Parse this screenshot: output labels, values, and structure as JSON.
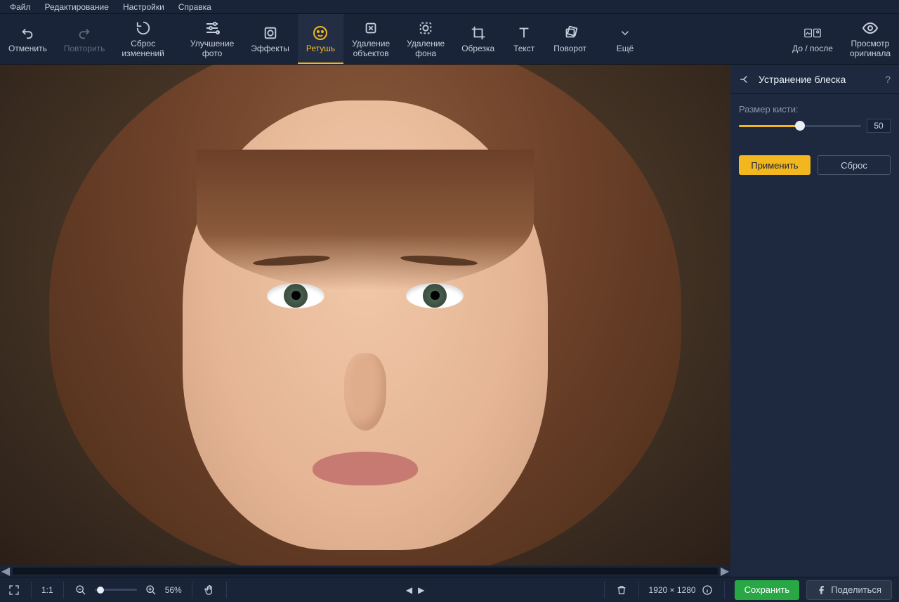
{
  "menubar": [
    "Файл",
    "Редактирование",
    "Настройки",
    "Справка"
  ],
  "toolbar": {
    "undo": "Отменить",
    "redo": "Повторить",
    "reset": "Сброс\nизменений",
    "enhance": "Улучшение\nфото",
    "effects": "Эффекты",
    "retouch": "Ретушь",
    "obj_remove": "Удаление\nобъектов",
    "bg_remove": "Удаление\nфона",
    "crop": "Обрезка",
    "text": "Текст",
    "rotate": "Поворот",
    "more": "Ещё",
    "before_after": "До / после",
    "view_original": "Просмотр\nоригинала"
  },
  "sidepanel": {
    "title": "Устранение блеска",
    "help": "?",
    "brush_label": "Размер кисти:",
    "brush_value": "50",
    "apply": "Применить",
    "reset": "Сброс"
  },
  "bottombar": {
    "one_to_one": "1:1",
    "zoom_pct": "56%",
    "dimensions": "1920 × 1280",
    "save": "Сохранить",
    "share": "Поделиться"
  },
  "colors": {
    "accent": "#f2b61e",
    "bg": "#1a2438",
    "panel": "#1e2940",
    "success": "#28a745"
  }
}
